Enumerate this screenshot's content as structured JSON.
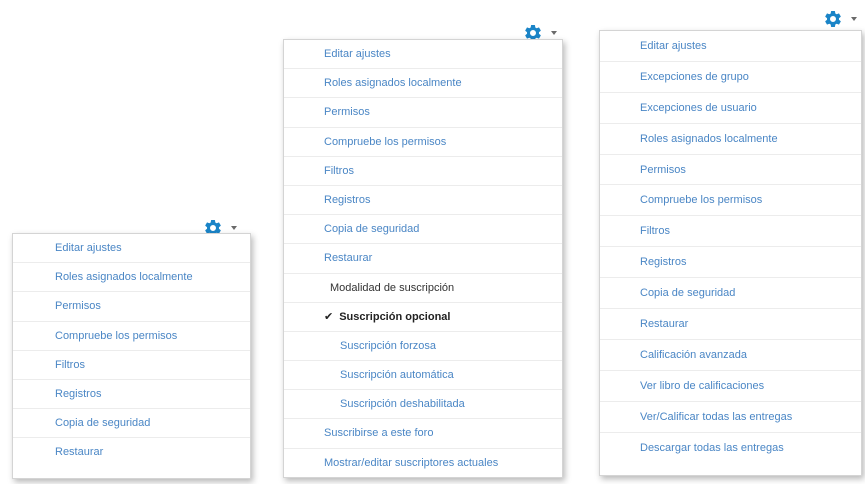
{
  "menu_left": {
    "items": [
      "Editar ajustes",
      "Roles asignados localmente",
      "Permisos",
      "Compruebe los permisos",
      "Filtros",
      "Registros",
      "Copia de seguridad",
      "Restaurar"
    ]
  },
  "menu_middle": {
    "items": [
      "Editar ajustes",
      "Roles asignados localmente",
      "Permisos",
      "Compruebe los permisos",
      "Filtros",
      "Registros",
      "Copia de seguridad",
      "Restaurar"
    ],
    "subscription_heading": "Modalidad de suscripción",
    "subscription_selected": "Suscripción opcional",
    "subscription_options": [
      "Suscripción forzosa",
      "Suscripción automática",
      "Suscripción deshabilitada"
    ],
    "subscribe_link": "Suscribirse a este foro",
    "show_subscribers_link": "Mostrar/editar suscriptores actuales"
  },
  "menu_right": {
    "items": [
      "Editar ajustes",
      "Excepciones de grupo",
      "Excepciones de usuario",
      "Roles asignados localmente",
      "Permisos",
      "Compruebe los permisos",
      "Filtros",
      "Registros",
      "Copia de seguridad",
      "Restaurar",
      "Calificación avanzada",
      "Ver libro de calificaciones",
      "Ver/Calificar todas las entregas",
      "Descargar todas las entregas"
    ]
  },
  "icons": {
    "gear": "gear-icon",
    "caret": "caret-down-icon",
    "check": "checkmark-icon"
  },
  "colors": {
    "gear": "#1a84c7",
    "link": "#4a86c5",
    "text": "#333333"
  }
}
